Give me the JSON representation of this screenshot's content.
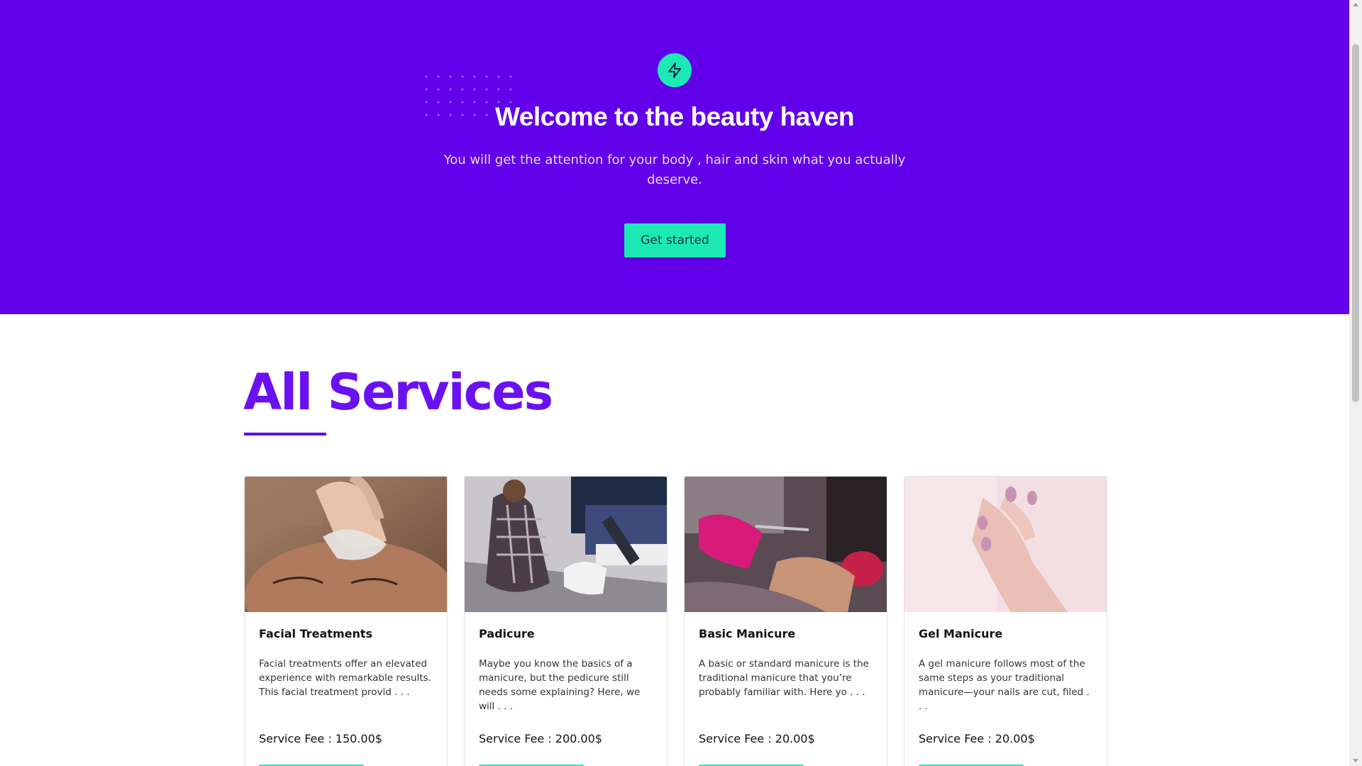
{
  "hero": {
    "icon": "lightning-bolt-icon",
    "title": "Welcome to the beauty haven",
    "subtitle": "You will get the attention for your body , hair and skin what you actually deserve.",
    "cta_label": "Get started",
    "background_color": "#6200ea",
    "accent_color": "#1de9b6"
  },
  "services": {
    "heading": "All Services",
    "heading_color": "#6a11f2",
    "cards": [
      {
        "name": "Facial Treatments",
        "description": "Facial treatments offer an elevated experience with remarkable results. This facial treatment provid . . .",
        "fee": "Service Fee : 150.00$",
        "image": "facial-treatment-photo"
      },
      {
        "name": "Padicure",
        "description": "Maybe you know the basics of a manicure, but the pedicure still needs some explaining? Here, we will . . .",
        "fee": "Service Fee : 200.00$",
        "image": "pedicure-photo"
      },
      {
        "name": "Basic Manicure",
        "description": "A basic or standard manicure is the traditional manicure that you’re probably familiar with. Here yo . . .",
        "fee": "Service Fee : 20.00$",
        "image": "basic-manicure-photo"
      },
      {
        "name": "Gel Manicure",
        "description": "A gel manicure follows most of the same steps as your traditional manicure—your nails are cut, filed . . .",
        "fee": "Service Fee : 20.00$",
        "image": "gel-manicure-photo"
      }
    ]
  }
}
